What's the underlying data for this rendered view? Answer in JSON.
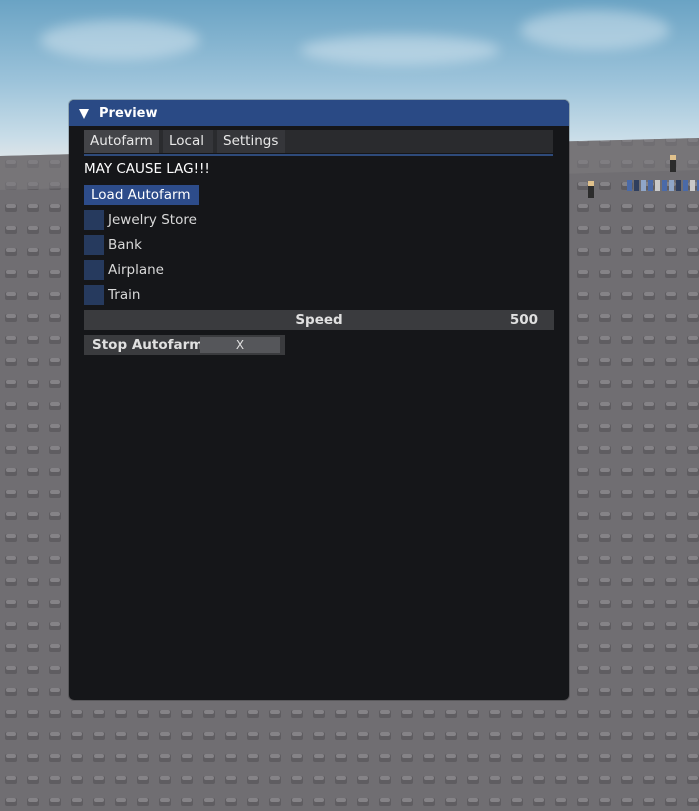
{
  "window": {
    "title": "Preview"
  },
  "tabs": [
    {
      "label": "Autofarm",
      "active": true
    },
    {
      "label": "Local",
      "active": false
    },
    {
      "label": "Settings",
      "active": false
    }
  ],
  "autofarm": {
    "warning_text": "MAY CAUSE LAG!!!",
    "load_button_label": "Load Autofarm",
    "checkboxes": [
      {
        "label": "Jewelry Store",
        "checked": false
      },
      {
        "label": "Bank",
        "checked": false
      },
      {
        "label": "Airplane",
        "checked": false
      },
      {
        "label": "Train",
        "checked": false
      }
    ],
    "speed_slider": {
      "label": "Speed",
      "value": "500"
    },
    "stop_keybind": {
      "label": "Stop Autofarm",
      "key": "X"
    }
  },
  "colors": {
    "title_bar": "#2a4a85",
    "window_bg": "#151619",
    "accent_button": "#2d4c8a",
    "checkbox": "#263a5e",
    "baseplate": "#6f6d70",
    "sky": "#9cc3da"
  },
  "icons": {
    "collapse": "triangle-down-icon"
  }
}
